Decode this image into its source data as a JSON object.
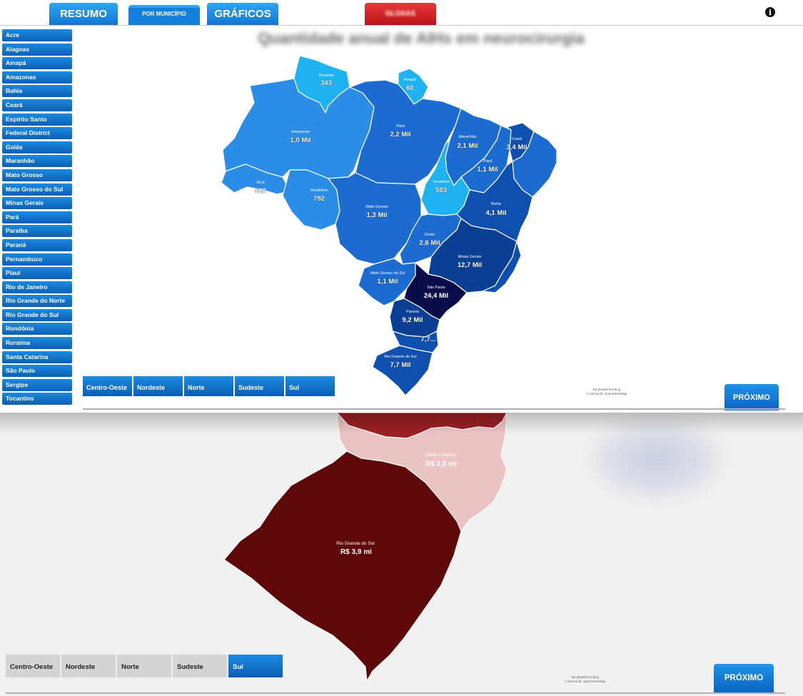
{
  "nav": {
    "resumo": "RESUMO",
    "por_municipio": "POR MUNICÍPIO",
    "graficos": "GRÁFICOS",
    "glosas": "GLOSAS",
    "info_icon": "info-icon"
  },
  "map_title": "Quantidade anual de AIHs em neurocirurgia",
  "states": [
    "Acre",
    "Alagoas",
    "Amapá",
    "Amazonas",
    "Bahia",
    "Ceará",
    "Espírito Santo",
    "Federal District",
    "Goiás",
    "Maranhão",
    "Mato Grosso",
    "Mato Grosso do Sul",
    "Minas Gerais",
    "Pará",
    "Paraíba",
    "Paraná",
    "Pernambuco",
    "Piauí",
    "Rio de Janeiro",
    "Rio Grande do Norte",
    "Rio Grande do Sul",
    "Rondônia",
    "Roraima",
    "Santa Catarina",
    "São Paulo",
    "Sergipe",
    "Tocantins"
  ],
  "brazil_map": {
    "colors": {
      "light": "#1eb3f0",
      "mid": "#2b8de6",
      "midDark": "#1b6bd0",
      "dark": "#0f4fb0",
      "darker": "#0a3f93",
      "darkest": "#0b0d4a"
    },
    "labels": {
      "roraima": {
        "name": "Roraima",
        "value": "343"
      },
      "amapa": {
        "name": "Amapá",
        "value": "60"
      },
      "amazonas": {
        "name": "Amazonas",
        "value": "1,0 Mil"
      },
      "para": {
        "name": "Pará",
        "value": "2,2 Mil"
      },
      "maranhao": {
        "name": "Maranhão",
        "value": "2,1 Mil"
      },
      "ceara": {
        "name": "Ceará",
        "value": "3,4 Mil"
      },
      "piaui": {
        "name": "Piauí",
        "value": "1,1 Mil"
      },
      "acre": {
        "name": "Acre",
        "value": "520"
      },
      "rondonia": {
        "name": "Rondônia",
        "value": "792"
      },
      "tocantins": {
        "name": "Tocantins",
        "value": "583"
      },
      "mato_grosso": {
        "name": "Mato Grosso",
        "value": "1,3 Mil"
      },
      "bahia": {
        "name": "Bahia",
        "value": "4,1 Mil"
      },
      "goias": {
        "name": "Goiás",
        "value": "2,6 Mil"
      },
      "minas_gerais": {
        "name": "Minas Gerais",
        "value": "12,7 Mil"
      },
      "mato_grosso_do_sul": {
        "name": "Mato Grosso do Sul",
        "value": "1,1 Mil"
      },
      "sao_paulo": {
        "name": "São Paulo",
        "value": "24,4 Mil"
      },
      "parana": {
        "name": "Paraná",
        "value": "9,2 Mil"
      },
      "santa_catarina": {
        "value": "7,7..."
      },
      "rio_grande_do_sul": {
        "name": "Rio Grande do Sul",
        "value": "7,7 Mil"
      }
    }
  },
  "regions": [
    "Centro-Oeste",
    "Nordeste",
    "Norte",
    "Sudeste",
    "Sul"
  ],
  "active_region_bottom": "Sul",
  "map_credit": {
    "line1": "Da plataforma Bing",
    "line2": "© Microsoft, OpenStreetMap"
  },
  "proximo": "PRÓXIMO",
  "rs_map": {
    "colors": {
      "sc": "#ebc3c3",
      "rs": "#5f0808",
      "pr": "#9a2024"
    },
    "santa_catarina": {
      "name": "Santa Catarina",
      "value": "R$ 2,0 mi"
    },
    "rio_grande_do_sul": {
      "name": "Rio Grande do Sul",
      "value": "R$ 3,9 mi"
    }
  }
}
